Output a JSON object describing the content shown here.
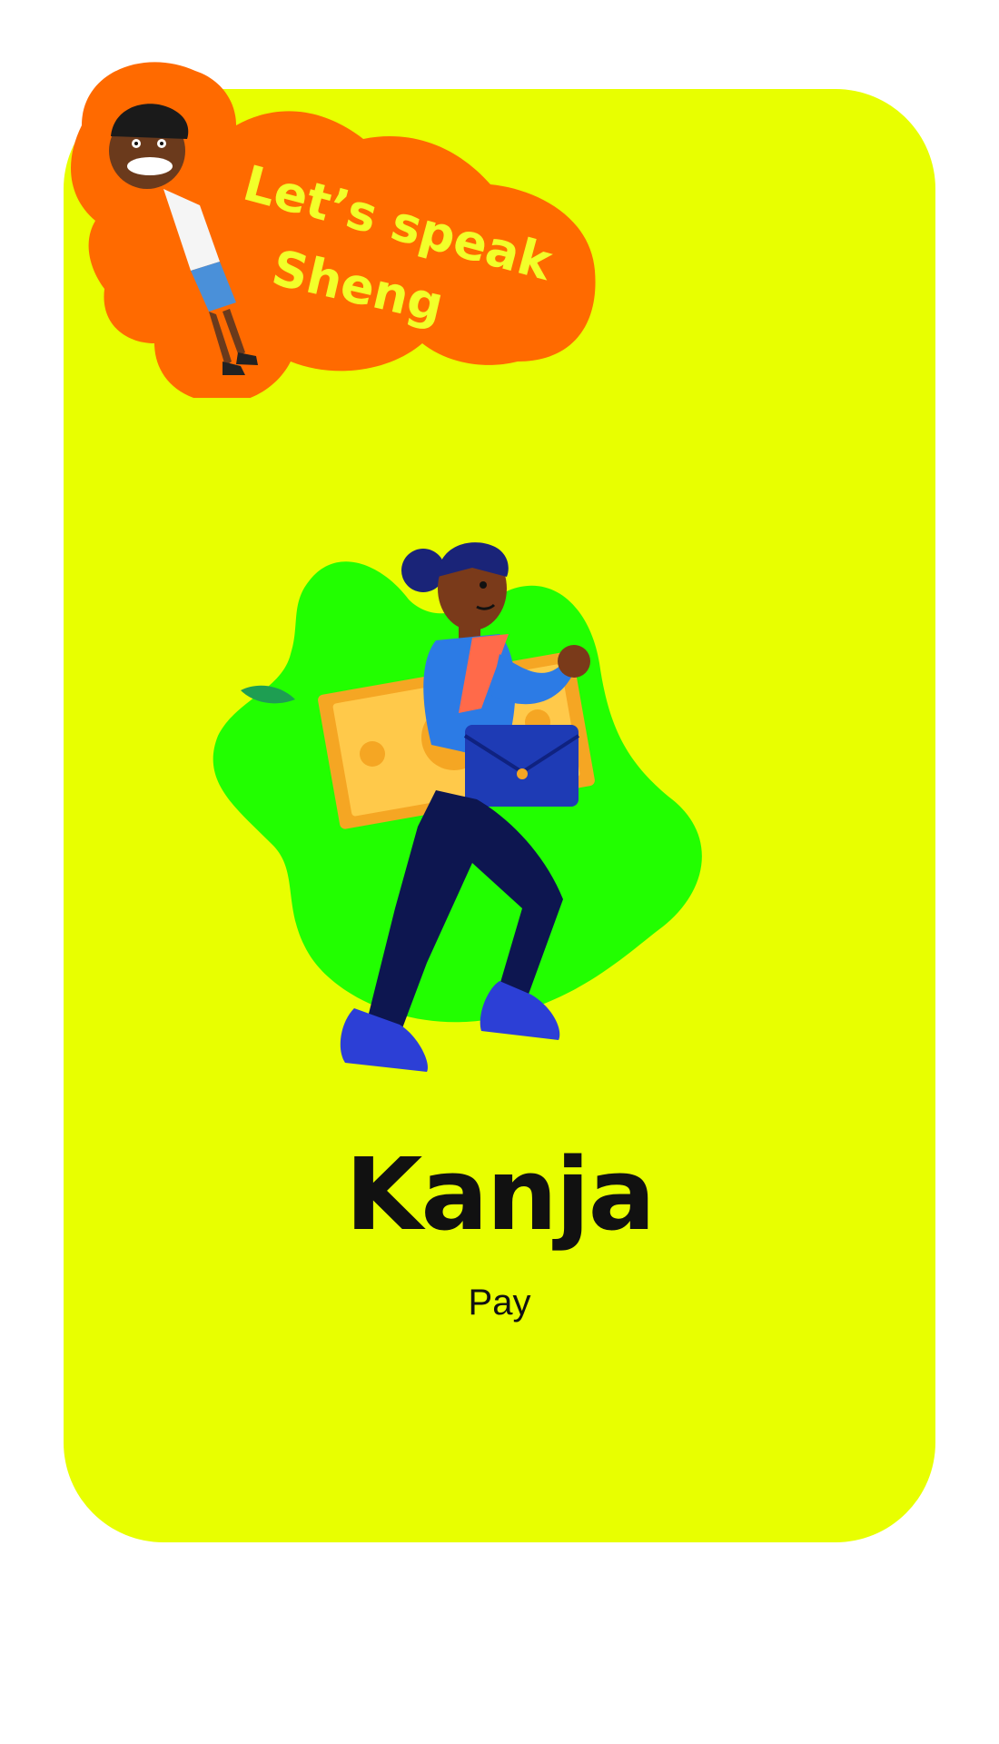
{
  "card": {
    "word": "Kanja",
    "translation": "Pay"
  },
  "sticker": {
    "line1": "Let’s speak",
    "line2": "Sheng"
  },
  "icons": {
    "sticker_character": "boy-character-icon",
    "main_illustration": "woman-carrying-money-illustration"
  },
  "colors": {
    "card_background": "#e8ff00",
    "blob": "#22ff00",
    "sticker_orange": "#ff6a00",
    "sticker_text": "#f2ff2a",
    "word_text": "#111111",
    "translation_text": "#111111"
  }
}
